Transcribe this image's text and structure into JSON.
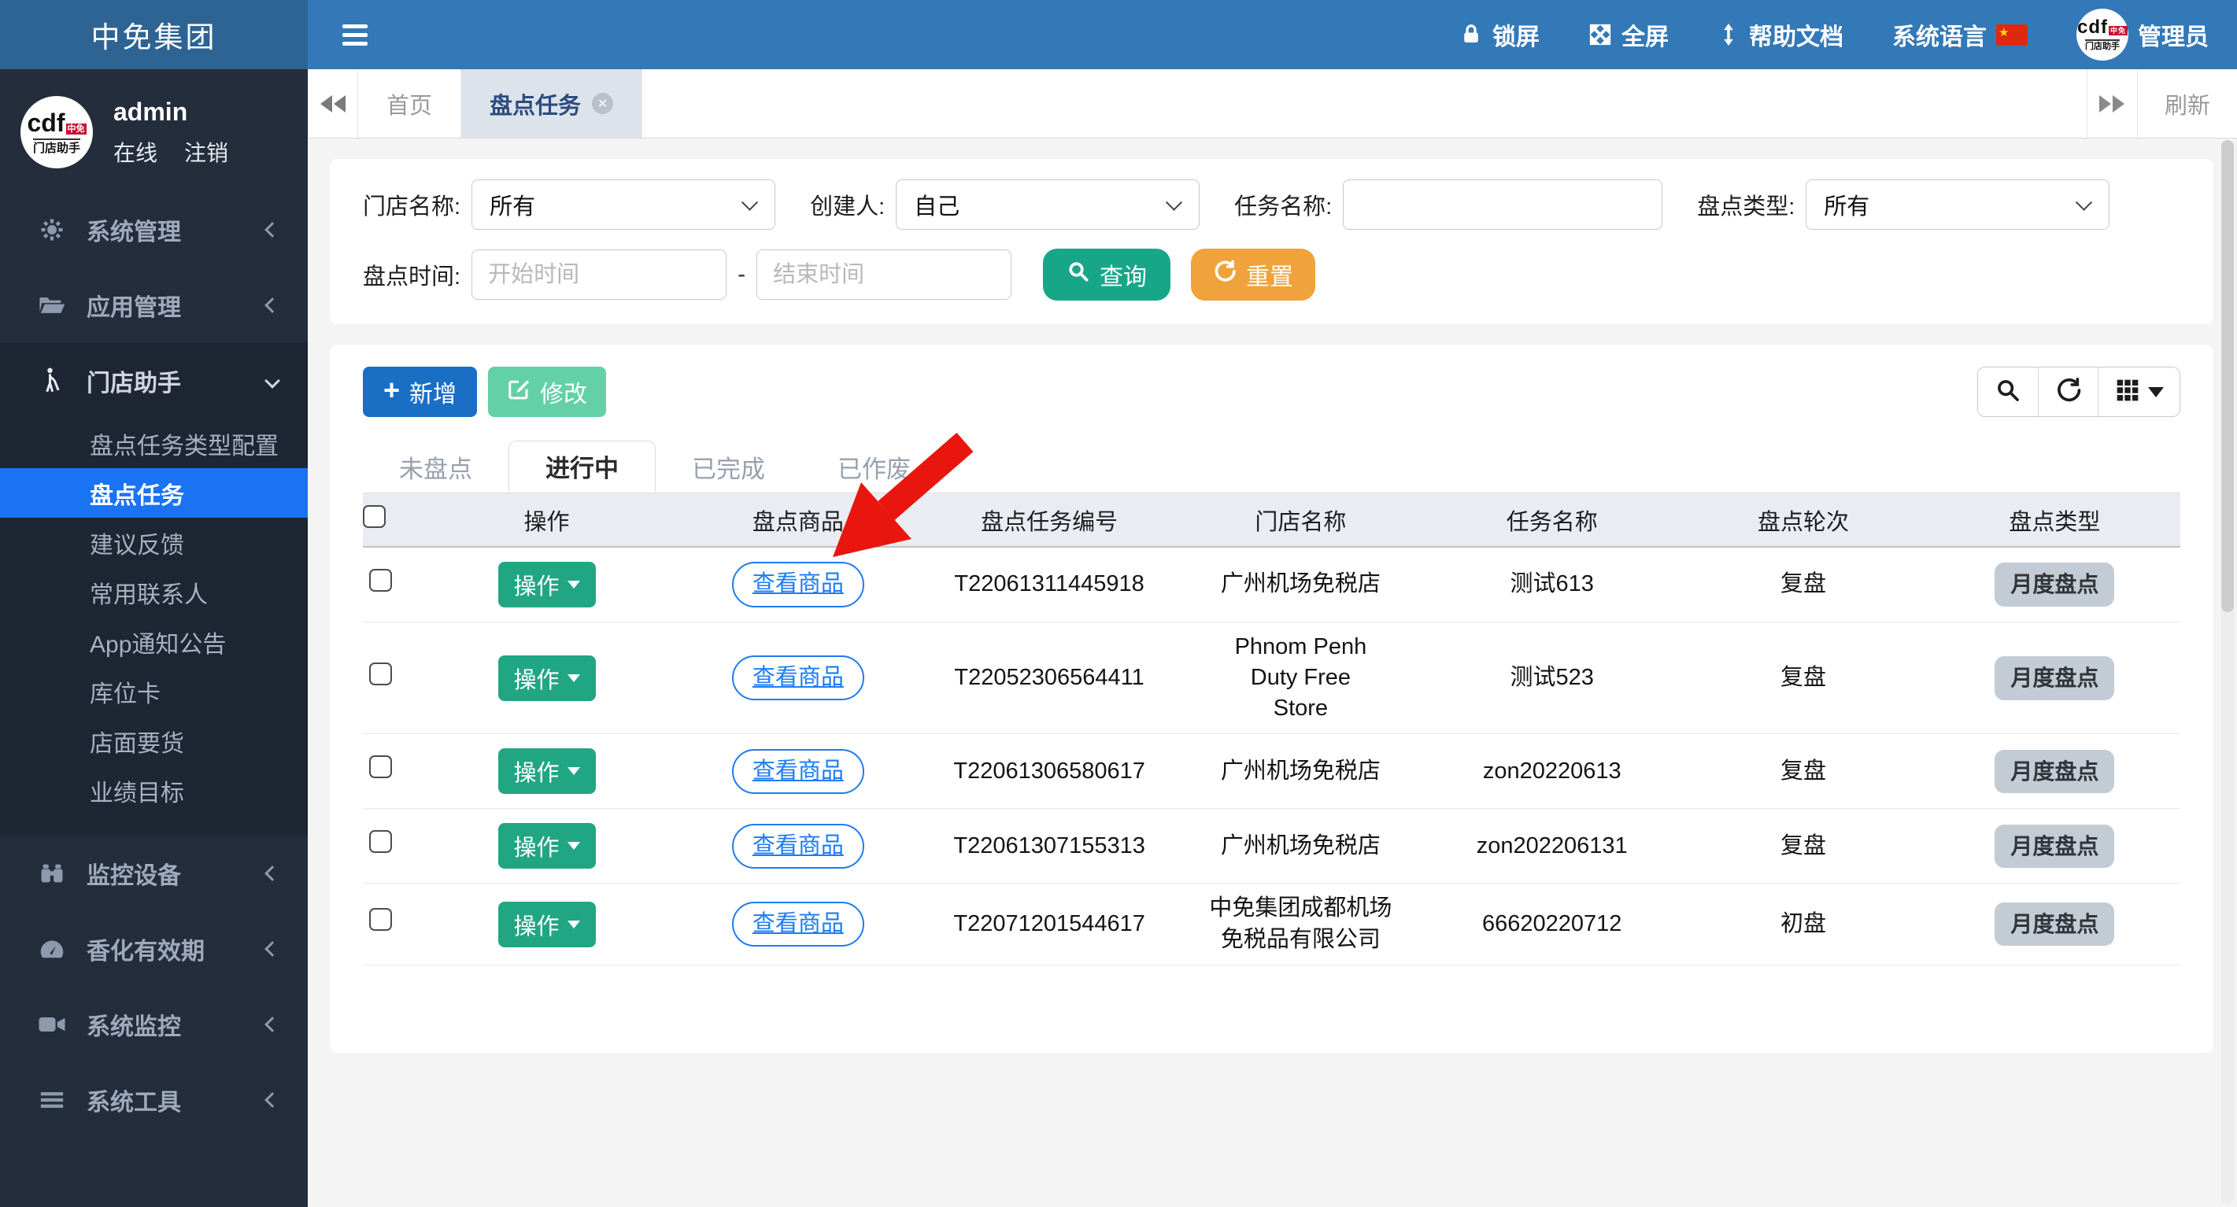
{
  "topbar": {
    "logo": "中免集团",
    "lock": "锁屏",
    "fullscreen": "全屏",
    "help": "帮助文档",
    "language": "系统语言",
    "admin": "管理员",
    "avatar_brand": "cdf",
    "avatar_sub": "门店助手"
  },
  "user": {
    "name": "admin",
    "status": "在线",
    "logout": "注销",
    "avatar_brand": "cdf",
    "avatar_sub": "门店助手"
  },
  "sidebar": {
    "items": [
      {
        "icon": "gear-icon",
        "label": "系统管理"
      },
      {
        "icon": "folder-open-icon",
        "label": "应用管理"
      },
      {
        "icon": "person-cane-icon",
        "label": "门店助手",
        "children": [
          "盘点任务类型配置",
          "盘点任务",
          "建议反馈",
          "常用联系人",
          "App通知公告",
          "库位卡",
          "店面要货",
          "业绩目标"
        ],
        "active_child": "盘点任务"
      },
      {
        "icon": "binoculars-icon",
        "label": "监控设备"
      },
      {
        "icon": "gauge-icon",
        "label": "香化有效期"
      },
      {
        "icon": "video-camera-icon",
        "label": "系统监控"
      },
      {
        "icon": "list-icon",
        "label": "系统工具"
      }
    ]
  },
  "tabstrip": {
    "home": "首页",
    "active_tab": "盘点任务",
    "refresh": "刷新"
  },
  "filters": {
    "store": {
      "label": "门店名称:",
      "value": "所有"
    },
    "creator": {
      "label": "创建人:",
      "value": "自己"
    },
    "task": {
      "label": "任务名称:",
      "value": ""
    },
    "type": {
      "label": "盘点类型:",
      "value": "所有"
    },
    "time": {
      "label": "盘点时间:",
      "start_placeholder": "开始时间",
      "end_placeholder": "结束时间",
      "separator": "-"
    },
    "query_label": "查询",
    "reset_label": "重置"
  },
  "toolbar": {
    "add_label": "新增",
    "edit_label": "修改"
  },
  "status_tabs": {
    "tabs": [
      "未盘点",
      "进行中",
      "已完成",
      "已作废"
    ],
    "active": "进行中"
  },
  "table": {
    "headers": [
      "操作",
      "盘点商品",
      "盘点任务编号",
      "门店名称",
      "任务名称",
      "盘点轮次",
      "盘点类型"
    ],
    "action_label": "操作",
    "view_label": "查看商品",
    "rows": [
      {
        "id": "T22061311445918",
        "store": "广州机场免税店",
        "task": "测试613",
        "round": "复盘",
        "type": "月度盘点"
      },
      {
        "id": "T22052306564411",
        "store": "Phnom Penh Duty Free Store",
        "task": "测试523",
        "round": "复盘",
        "type": "月度盘点"
      },
      {
        "id": "T22061306580617",
        "store": "广州机场免税店",
        "task": "zon20220613",
        "round": "复盘",
        "type": "月度盘点"
      },
      {
        "id": "T22061307155313",
        "store": "广州机场免税店",
        "task": "zon202206131",
        "round": "复盘",
        "type": "月度盘点"
      },
      {
        "id": "T22071201544617",
        "store": "中免集团成都机场免税品有限公司",
        "task": "66620220712",
        "round": "初盘",
        "type": "月度盘点"
      }
    ]
  },
  "colors": {
    "topbar_blue": "#3379b7",
    "logo_blue": "#2d6493",
    "sidebar_dark": "#232d3b",
    "active_menu_blue": "#1973f2",
    "query_green": "#18a689",
    "reset_orange": "#f0a23c",
    "add_blue": "#1a6fc4",
    "edit_teal": "#63d0a8",
    "action_green": "#21a683",
    "link_blue": "#1e7cf2",
    "badge_gray": "#c3ccd4",
    "arrow_red": "#e8160f"
  }
}
